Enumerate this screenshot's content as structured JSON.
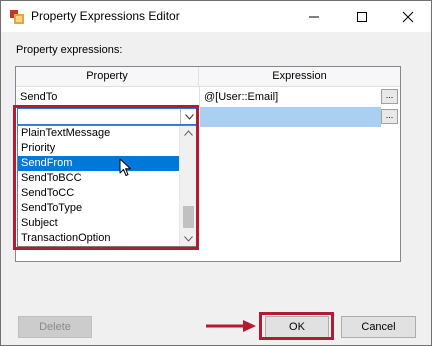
{
  "window": {
    "title": "Property Expressions Editor"
  },
  "section_label": "Property expressions:",
  "grid": {
    "headers": {
      "property": "Property",
      "expression": "Expression"
    },
    "rows": [
      {
        "property": "SendTo",
        "expression": "@[User::Email]",
        "button": "..."
      },
      {
        "property": "",
        "expression": "",
        "button": "..."
      }
    ]
  },
  "dropdown": {
    "items": [
      "PlainTextMessage",
      "Priority",
      "SendFrom",
      "SendToBCC",
      "SendToCC",
      "SendToType",
      "Subject",
      "TransactionOption"
    ],
    "selected": "SendFrom"
  },
  "buttons": {
    "delete": "Delete",
    "ok": "OK",
    "cancel": "Cancel"
  },
  "colors": {
    "callout": "#b31b34",
    "selection": "#0078d7",
    "row_highlight": "#a9cff2"
  },
  "icons": [
    "app-icon",
    "minimize-icon",
    "maximize-icon",
    "close-icon",
    "chevron-down-icon",
    "scroll-up-icon",
    "scroll-down-icon",
    "mouse-cursor-icon",
    "arrow-icon"
  ]
}
